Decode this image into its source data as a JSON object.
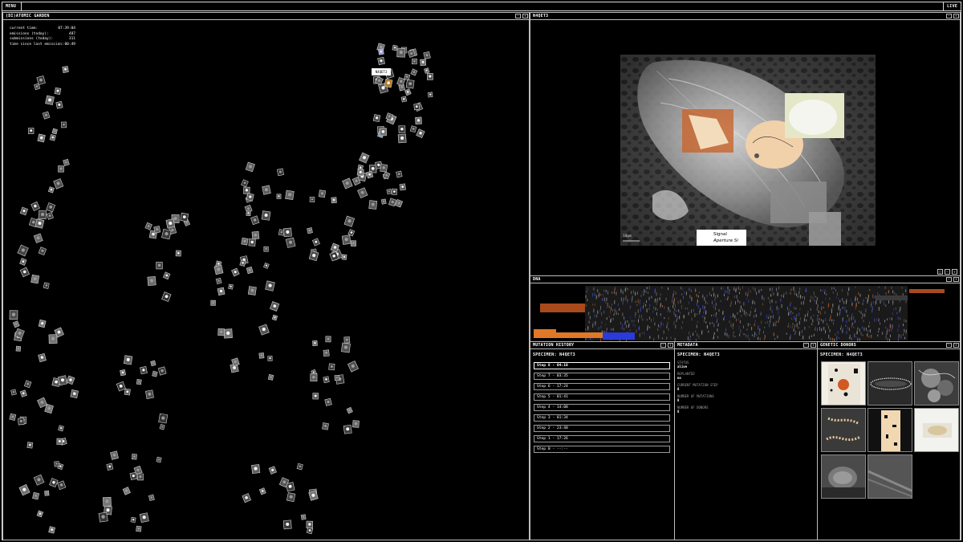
{
  "topbar": {
    "menu_label": "MENU",
    "live_label": "LIVE"
  },
  "garden": {
    "title": "(DI)ATOMIC GARDEN",
    "stats": [
      {
        "label": "current time:",
        "value": "07:39:04"
      },
      {
        "label": "emissions (today):",
        "value": "487"
      },
      {
        "label": "submissions (today):",
        "value": "311"
      },
      {
        "label": "time since last emission:",
        "value": "00:49"
      }
    ],
    "hover_tag": "N4QET3"
  },
  "viewer": {
    "title": "N4QET3",
    "scale_text": "10µm",
    "overlay_line1": "Signal",
    "overlay_line2": "Aperture Si"
  },
  "dna": {
    "title": "DNA"
  },
  "mutation_history": {
    "title": "MUTATION HISTORY",
    "specimen": "SPECIMEN: N4QET3",
    "steps": [
      "Step 8 - 04:10",
      "Step 7 - 03:35",
      "Step 6 - 17:24",
      "Step 5 - 01:41",
      "Step 4 - 14:08",
      "Step 3 - 01:34",
      "Step 2 - 23:40",
      "Step 1 - 17:26",
      "Step 0 - --:--"
    ]
  },
  "metadata": {
    "title": "METADATA",
    "specimen": "SPECIMEN: N4QET3",
    "fields": [
      {
        "label": "STATUS",
        "value": "alive"
      },
      {
        "label": "REPLANTED",
        "value": "no"
      },
      {
        "label": "CURRENT MUTATION STEP",
        "value": "8"
      },
      {
        "label": "NUMBER OF MUTATIONS",
        "value": "8"
      },
      {
        "label": "NUMBER OF DONORS",
        "value": "8"
      }
    ]
  },
  "donors": {
    "title": "GENETIC DONORS",
    "specimen": "SPECIMEN: N4QET3"
  },
  "controls": {
    "minimize": "–",
    "maximize": "+"
  }
}
